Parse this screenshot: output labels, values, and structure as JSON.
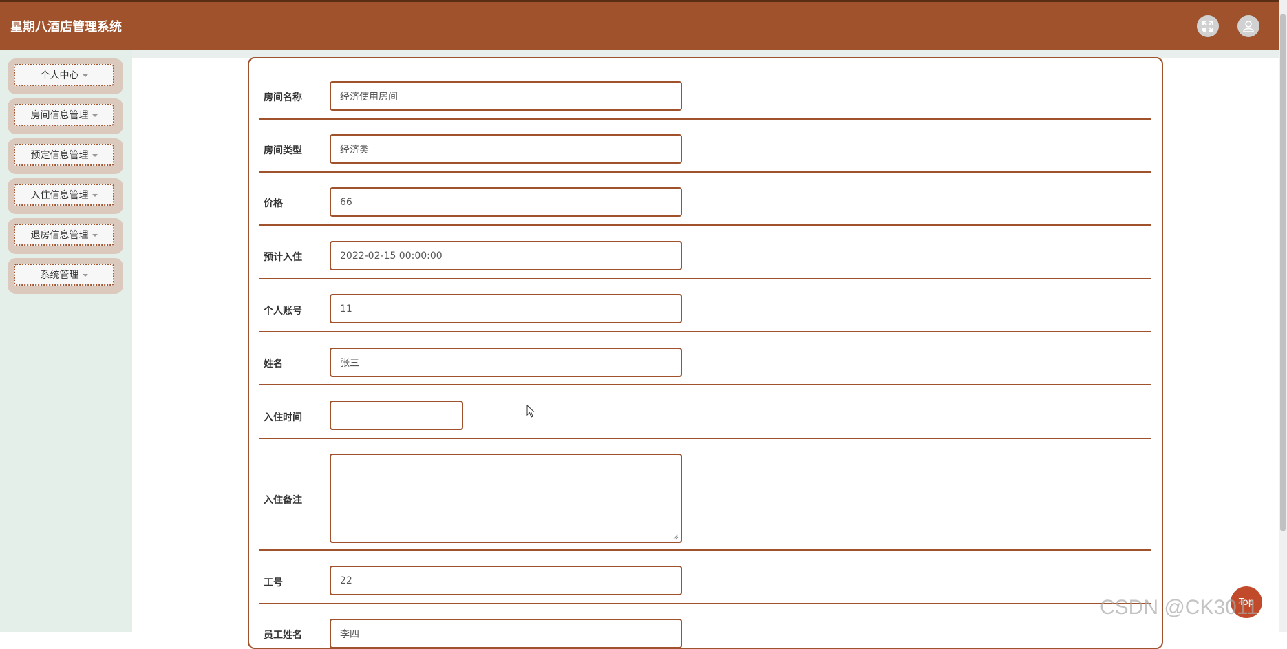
{
  "app": {
    "title": "星期八酒店管理系统"
  },
  "header": {
    "icons": [
      "fullscreen-icon",
      "user-icon"
    ]
  },
  "sidebar": {
    "items": [
      {
        "label": "个人中心"
      },
      {
        "label": "房间信息管理"
      },
      {
        "label": "预定信息管理"
      },
      {
        "label": "入住信息管理"
      },
      {
        "label": "退房信息管理"
      },
      {
        "label": "系统管理"
      }
    ]
  },
  "form": {
    "fields": [
      {
        "label": "房间名称",
        "value": "经济使用房间"
      },
      {
        "label": "房间类型",
        "value": "经济类"
      },
      {
        "label": "价格",
        "value": "66"
      },
      {
        "label": "预计入住",
        "value": "2022-02-15 00:00:00"
      },
      {
        "label": "个人账号",
        "value": "11"
      },
      {
        "label": "姓名",
        "value": "张三"
      },
      {
        "label": "入住时间",
        "value": ""
      },
      {
        "label": "入住备注",
        "value": ""
      },
      {
        "label": "工号",
        "value": "22"
      },
      {
        "label": "员工姓名",
        "value": "李四"
      }
    ]
  },
  "misc": {
    "top_button": "Top",
    "watermark": "CSDN @CK3011"
  },
  "colors": {
    "brand": "#a0522d",
    "sidebar_bg": "#e5efea",
    "sidebar_item": "#dcc9bd"
  }
}
